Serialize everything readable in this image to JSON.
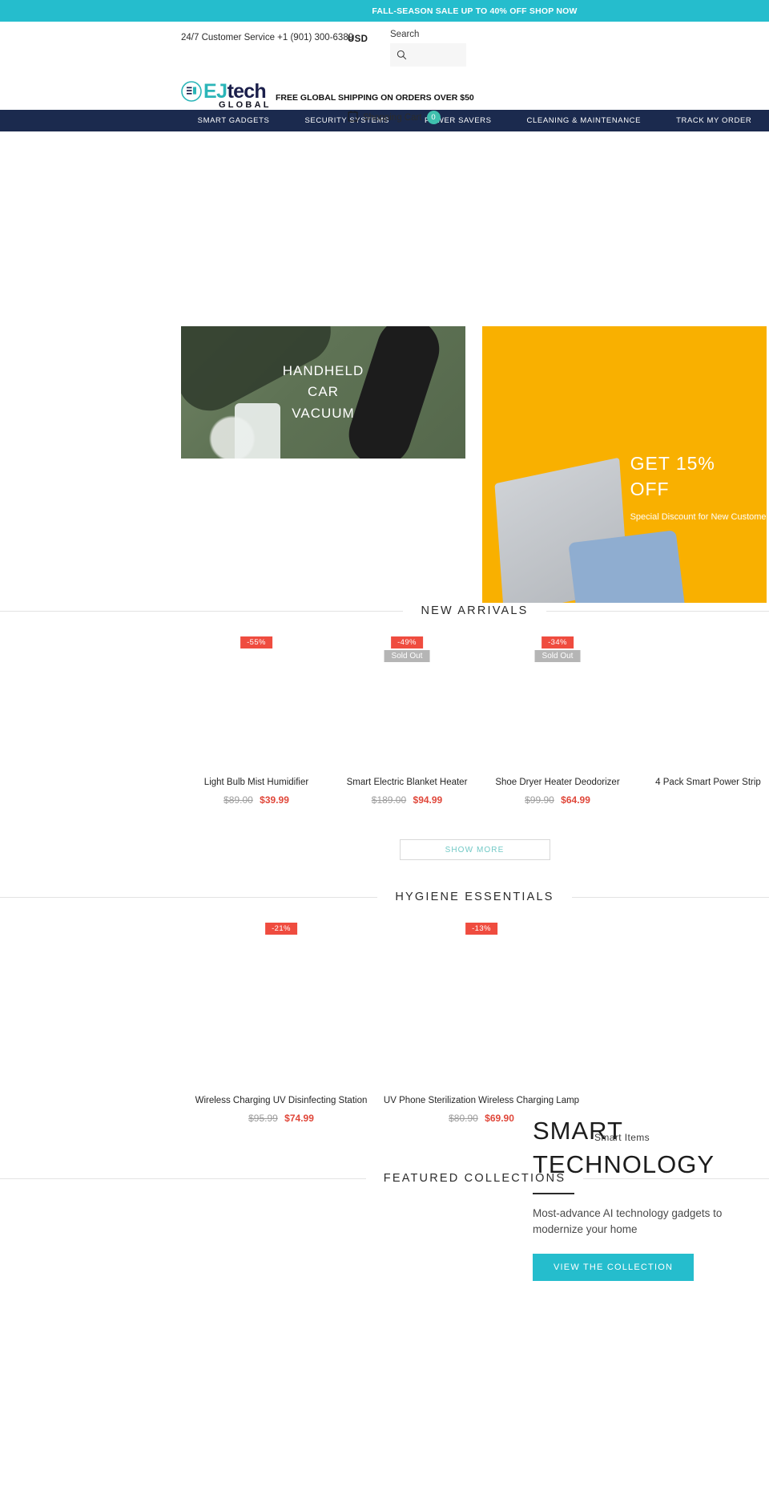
{
  "announcement": {
    "text": "FALL-SEASON SALE UP TO 40% OFF SHOP NOW"
  },
  "header": {
    "phone": "24/7 Customer Service +1 (901) 300-6389",
    "currency": "USD",
    "search_label": "Search",
    "search_placeholder": "",
    "search_value": "",
    "logo": {
      "ej": "EJ",
      "tech": "tech",
      "global": "GLOBAL"
    },
    "shipping_note": "FREE GLOBAL SHIPPING ON ORDERS OVER $50",
    "cart_label": "Shopping Cart",
    "cart_count": "0"
  },
  "nav": {
    "items": [
      {
        "label": "SMART GADGETS"
      },
      {
        "label": "SECURITY SYSTEMS"
      },
      {
        "label": "POWER SAVERS"
      },
      {
        "label": "CLEANING & MAINTENANCE"
      },
      {
        "label": "TRACK MY ORDER"
      }
    ]
  },
  "hero": {
    "left_banner": {
      "line1": "HANDHELD",
      "line2": "CAR",
      "line3": "VACUUM"
    },
    "right_banner": {
      "line1": "GET 15%",
      "line2": "OFF",
      "subtitle": "Special Discount for New Customers"
    }
  },
  "new_arrivals": {
    "title": "NEW ARRIVALS",
    "show_more": "SHOW MORE",
    "products": [
      {
        "name": "Light Bulb Mist Humidifier",
        "discount": "-55%",
        "sold_out": "",
        "price_old": "$89.00",
        "price_new": "$39.99"
      },
      {
        "name": "Smart Electric Blanket Heater",
        "discount": "-49%",
        "sold_out": "Sold Out",
        "price_old": "$189.00",
        "price_new": "$94.99"
      },
      {
        "name": "Shoe Dryer Heater Deodorizer",
        "discount": "-34%",
        "sold_out": "Sold Out",
        "price_old": "$99.90",
        "price_new": "$64.99"
      },
      {
        "name": "4 Pack Smart Power Strip",
        "discount": "",
        "sold_out": "",
        "price_old": "",
        "price_new": ""
      }
    ]
  },
  "hygiene": {
    "title": "HYGIENE ESSENTIALS",
    "products": [
      {
        "name": "Wireless Charging UV Disinfecting Station",
        "discount": "-21%",
        "sold_out": "",
        "price_old": "$95.99",
        "price_new": "$74.99"
      },
      {
        "name": "UV Phone Sterilization Wireless Charging Lamp",
        "discount": "-13%",
        "sold_out": "",
        "price_old": "$80.90",
        "price_new": "$69.90"
      }
    ]
  },
  "smart_tech": {
    "eyebrow": "Smart Items",
    "title_line1": "SMART",
    "title_line2": "TECHNOLOGY",
    "description": "Most-advance AI technology gadgets to modernize your home",
    "cta": "VIEW THE COLLECTION"
  },
  "featured": {
    "title": "FEATURED COLLECTIONS"
  },
  "colors": {
    "accent": "#25bdcd",
    "nav_bg": "#1b2a4e",
    "sale_badge": "#ef4c3f",
    "sold_badge": "#b5b5b5",
    "price_new": "#e0473a",
    "banner_yellow": "#f9b000",
    "cart_badge": "#3fc0ae"
  }
}
